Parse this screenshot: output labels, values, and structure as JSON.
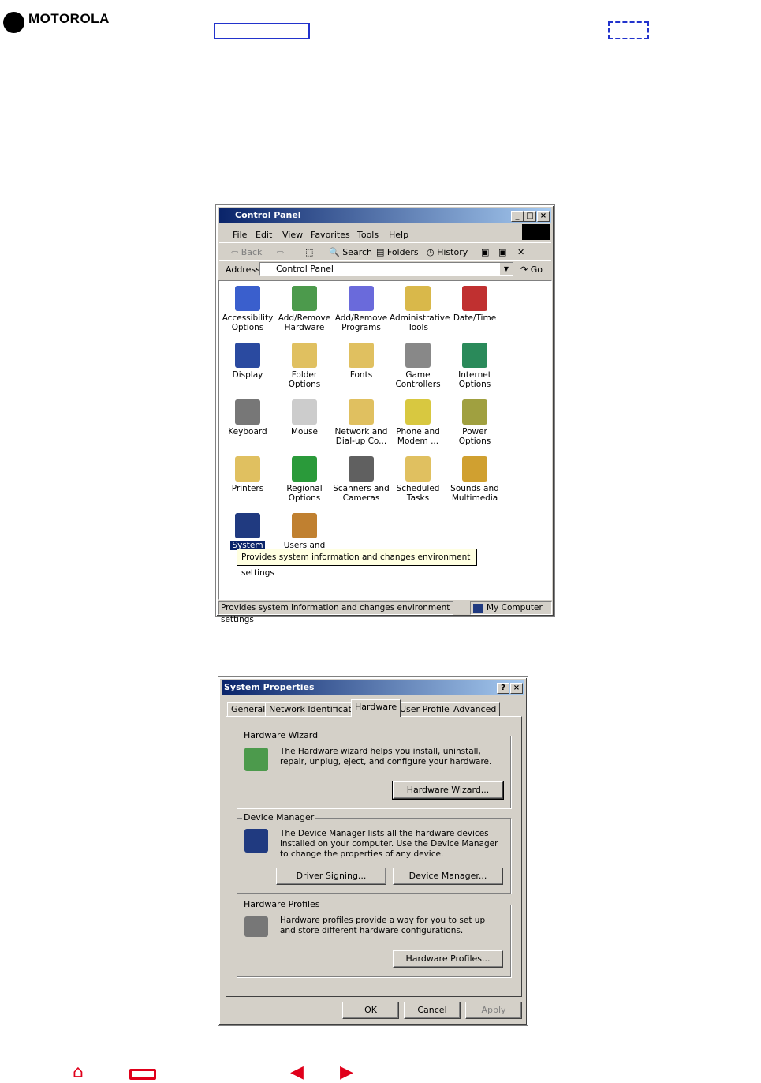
{
  "header": {
    "brand": "MOTOROLA"
  },
  "control_panel": {
    "title": "Control Panel",
    "menu": [
      "File",
      "Edit",
      "View",
      "Favorites",
      "Tools",
      "Help"
    ],
    "toolbar": {
      "back": "Back",
      "search": "Search",
      "folders": "Folders",
      "history": "History"
    },
    "address": {
      "label": "Address",
      "value": "Control Panel",
      "go": "Go"
    },
    "icons": [
      {
        "label": "Accessibility Options",
        "color": "#3a5fcd"
      },
      {
        "label": "Add/Remove Hardware",
        "color": "#4c9a4c"
      },
      {
        "label": "Add/Remove Programs",
        "color": "#6a6adb"
      },
      {
        "label": "Administrative Tools",
        "color": "#d9b84a"
      },
      {
        "label": "Date/Time",
        "color": "#c03030"
      },
      {
        "label": "Display",
        "color": "#2a4aa0"
      },
      {
        "label": "Folder Options",
        "color": "#e0c060"
      },
      {
        "label": "Fonts",
        "color": "#e0c060"
      },
      {
        "label": "Game Controllers",
        "color": "#888888"
      },
      {
        "label": "Internet Options",
        "color": "#2a8a5a"
      },
      {
        "label": "Keyboard",
        "color": "#777777"
      },
      {
        "label": "Mouse",
        "color": "#cccccc"
      },
      {
        "label": "Network and Dial-up Co...",
        "color": "#e0c060"
      },
      {
        "label": "Phone and Modem ...",
        "color": "#d8c840"
      },
      {
        "label": "Power Options",
        "color": "#a0a040"
      },
      {
        "label": "Printers",
        "color": "#e0c060"
      },
      {
        "label": "Regional Options",
        "color": "#2a9a3a"
      },
      {
        "label": "Scanners and Cameras",
        "color": "#606060"
      },
      {
        "label": "Scheduled Tasks",
        "color": "#e0c060"
      },
      {
        "label": "Sounds and Multimedia",
        "color": "#d0a030"
      },
      {
        "label": "System",
        "color": "#203a80"
      },
      {
        "label": "Users and",
        "color": "#c08030"
      }
    ],
    "tooltip": "Provides system information and changes environment settings",
    "status_text": "Provides system information and changes environment settings",
    "status_zone": "My Computer"
  },
  "system_properties": {
    "title": "System Properties",
    "tabs": [
      "General",
      "Network Identification",
      "Hardware",
      "User Profiles",
      "Advanced"
    ],
    "groups": {
      "wizard": {
        "label": "Hardware Wizard",
        "text": "The Hardware wizard helps you install, uninstall, repair, unplug, eject, and configure your hardware.",
        "button": "Hardware Wizard..."
      },
      "device": {
        "label": "Device Manager",
        "text": "The Device Manager lists all the hardware devices installed on your computer. Use the Device Manager to change the properties of any device.",
        "button1": "Driver Signing...",
        "button2": "Device Manager..."
      },
      "profiles": {
        "label": "Hardware Profiles",
        "text": "Hardware profiles provide a way for you to set up and store different hardware configurations.",
        "button": "Hardware Profiles..."
      }
    },
    "buttons": {
      "ok": "OK",
      "cancel": "Cancel",
      "apply": "Apply"
    }
  }
}
